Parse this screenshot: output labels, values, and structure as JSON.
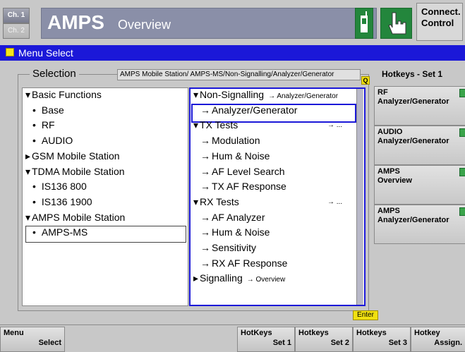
{
  "header": {
    "ch1": "Ch. 1",
    "ch2": "Ch. 2",
    "title": "AMPS",
    "subtitle": "Overview",
    "connect": "Connect. Control"
  },
  "menu_bar": {
    "label": "Menu Select"
  },
  "selection": {
    "label": "Selection",
    "breadcrumb": "AMPS Mobile Station/ AMPS-MS/Non-Signalling/Analyzer/Generator",
    "q_badge": "Q",
    "enter_badge": "Enter"
  },
  "left_tree": [
    {
      "label": "Basic Functions",
      "marker": "▾"
    },
    {
      "label": "Base",
      "marker": "•"
    },
    {
      "label": "RF",
      "marker": "•"
    },
    {
      "label": "AUDIO",
      "marker": "•"
    },
    {
      "label": "GSM Mobile Station",
      "marker": "▸"
    },
    {
      "label": "TDMA Mobile Station",
      "marker": "▾"
    },
    {
      "label": "IS136 800",
      "marker": "•"
    },
    {
      "label": "IS136 1900",
      "marker": "•"
    },
    {
      "label": "AMPS Mobile Station",
      "marker": "▾"
    },
    {
      "label": "AMPS-MS",
      "marker": "•"
    }
  ],
  "right_tree": [
    {
      "label": "Non-Signalling",
      "marker": "▾",
      "note": "→ Analyzer/Generator"
    },
    {
      "label": "Analyzer/Generator",
      "marker": "→",
      "note": ""
    },
    {
      "label": "TX Tests",
      "marker": "▾",
      "note": "→ ..."
    },
    {
      "label": "Modulation",
      "marker": "→",
      "note": ""
    },
    {
      "label": "Hum & Noise",
      "marker": "→",
      "note": ""
    },
    {
      "label": "AF Level Search",
      "marker": "→",
      "note": ""
    },
    {
      "label": "TX AF Response",
      "marker": "→",
      "note": ""
    },
    {
      "label": "RX Tests",
      "marker": "▾",
      "note": "→ ..."
    },
    {
      "label": "AF Analyzer",
      "marker": "→",
      "note": ""
    },
    {
      "label": "Hum & Noise",
      "marker": "→",
      "note": ""
    },
    {
      "label": "Sensitivity",
      "marker": "→",
      "note": ""
    },
    {
      "label": "RX AF Response",
      "marker": "→",
      "note": ""
    },
    {
      "label": "Signalling",
      "marker": "▸",
      "note": "→ Overview"
    }
  ],
  "hotkeys": {
    "title": "Hotkeys - Set 1",
    "buttons": [
      {
        "line1": "RF",
        "line2": "Analyzer/Generator"
      },
      {
        "line1": "AUDIO",
        "line2": "Analyzer/Generator"
      },
      {
        "line1": "AMPS",
        "line2": "Overview"
      },
      {
        "line1": "AMPS",
        "line2": "Analyzer/Generator"
      }
    ]
  },
  "softkeys": {
    "menu": {
      "l1": "Menu",
      "l2": "Select"
    },
    "set1": {
      "l1": "HotKeys",
      "l2": "Set 1"
    },
    "set2": {
      "l1": "Hotkeys",
      "l2": "Set 2"
    },
    "set3": {
      "l1": "Hotkeys",
      "l2": "Set 3"
    },
    "assign": {
      "l1": "Hotkey",
      "l2": "Assign."
    }
  }
}
